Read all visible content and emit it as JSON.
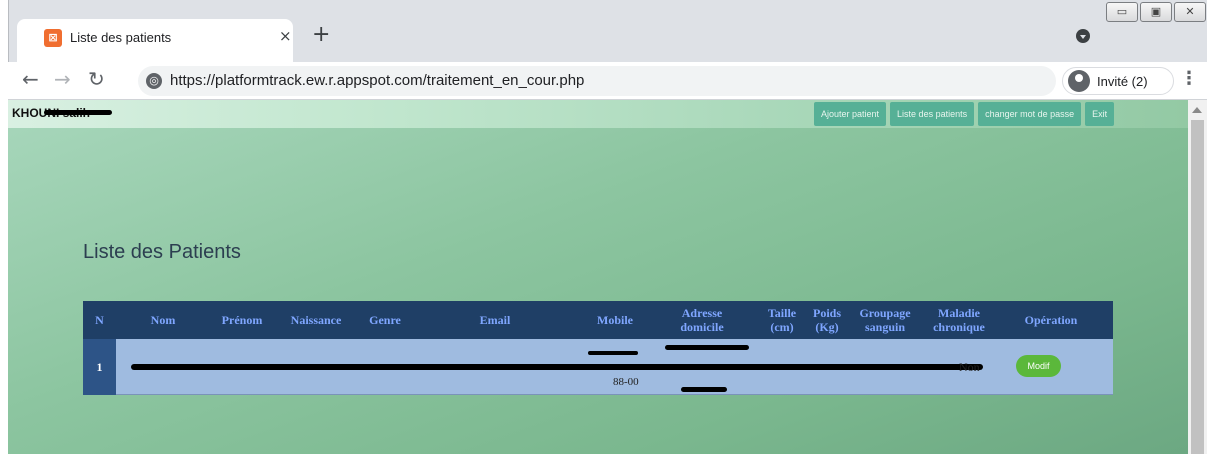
{
  "browser": {
    "tab_title": "Liste des patients",
    "tab_close": "×",
    "new_tab": "+",
    "url": "https://platformtrack.ew.r.appspot.com/traitement_en_cour.php",
    "guest_label": "Invité (2)",
    "favicon_letter": "⊠",
    "window_controls": [
      "▭",
      "▣",
      "✕"
    ]
  },
  "header": {
    "user_name": "KHOUNI salih",
    "nav_buttons": [
      "Ajouter patient",
      "Liste des patients",
      "changer mot de passe",
      "Exit"
    ]
  },
  "main": {
    "heading": "Liste des Patients",
    "table": {
      "columns": [
        "N",
        "Nom",
        "Prénom",
        "Naissance",
        "Genre",
        "Email",
        "Mobile",
        "Adresse domicile",
        "Taille (cm)",
        "Poids (Kg)",
        "Groupage sanguin",
        "Maladie chronique",
        "Opération"
      ],
      "rows": [
        {
          "n": "1",
          "mobile_visible": "88-00",
          "maladie": "Non",
          "operation": "Modif"
        }
      ]
    }
  },
  "icons": {
    "back": "arrow-left-icon",
    "forward": "arrow-right-icon",
    "reload": "reload-icon",
    "site_info": "globe-icon",
    "profile": "account-icon",
    "menu": "kebab-menu-icon"
  },
  "colors": {
    "table_header": "#1f3f66",
    "table_header_text": "#7fa6ff",
    "row_bg": "#9fbbe0",
    "button_green": "#5bb83b",
    "nav_button": "#56b096"
  }
}
